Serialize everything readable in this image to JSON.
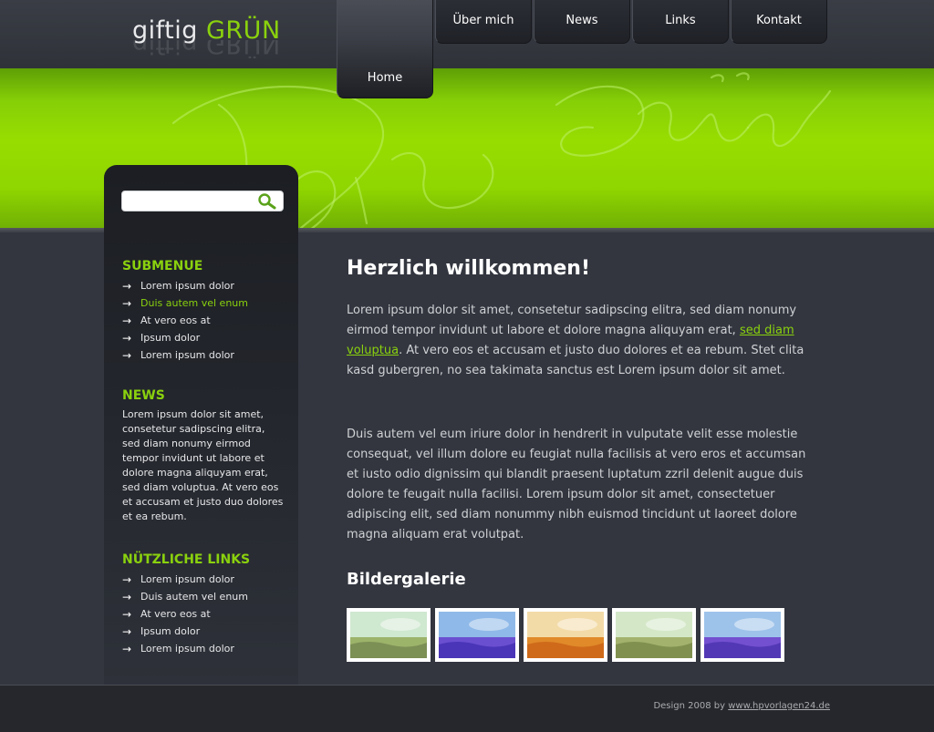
{
  "logo": {
    "part1": "giftig",
    "part2": "GRÜN"
  },
  "nav": {
    "home": "Home",
    "items": [
      "Über mich",
      "News",
      "Links",
      "Kontakt"
    ]
  },
  "colors": {
    "accent": "#8ad10e",
    "background": "#33363f",
    "sidebar": "#1c1e23"
  },
  "search": {
    "placeholder": "",
    "icon": "search-icon"
  },
  "sidebar": {
    "submenu_heading": "SUBMENUE",
    "submenu_items": [
      "Lorem ipsum dolor",
      "Duis autem vel enum",
      "At vero eos at",
      "Ipsum dolor",
      "Lorem ipsum dolor"
    ],
    "submenu_active_index": 1,
    "news_heading": "NEWS",
    "news_text": "Lorem ipsum dolor sit amet, consetetur sadipscing elitra, sed diam nonumy eirmod tempor invidunt ut labore et dolore magna aliquyam erat, sed diam voluptua. At vero eos et accusam et justo duo dolores et ea rebum.",
    "links_heading": "NÜTZLICHE LINKS",
    "links_items": [
      "Lorem ipsum dolor",
      "Duis autem vel enum",
      "At vero eos at",
      "Ipsum dolor",
      "Lorem ipsum dolor"
    ]
  },
  "main": {
    "title": "Herzlich willkommen!",
    "para1_before": "Lorem ipsum dolor sit amet, consetetur sadipscing elitra, sed diam nonumy eirmod tempor invidunt ut labore et dolore magna aliquyam erat, ",
    "para1_link": "sed diam voluptua",
    "para1_after": ". At vero eos et accusam et justo duo dolores et ea rebum. Stet clita kasd gubergren, no sea takimata sanctus est Lorem ipsum dolor sit amet.",
    "para2": "Duis autem vel eum iriure dolor in hendrerit in vulputate velit esse molestie consequat, vel illum dolore eu feugiat nulla facilisis at vero eros et accumsan et iusto odio dignissim qui blandit praesent luptatum zzril delenit augue duis dolore te feugait nulla facilisi. Lorem ipsum dolor sit amet, consectetuer adipiscing elit, sed diam nonummy nibh euismod tincidunt ut laoreet dolore magna aliquam erat volutpat.",
    "gallery_title": "Bildergalerie",
    "gallery": [
      {
        "name": "gallery-thumb-green",
        "sky": "#cfe8d0",
        "field": "#9cb36a",
        "ground": "#7c8f55"
      },
      {
        "name": "gallery-thumb-blue",
        "sky": "#8fb9e8",
        "field": "#6a4fd0",
        "ground": "#4a35b8"
      },
      {
        "name": "gallery-thumb-orange",
        "sky": "#f3dba8",
        "field": "#e08a2a",
        "ground": "#cf6a1a"
      },
      {
        "name": "gallery-thumb-green-2",
        "sky": "#d4e8c8",
        "field": "#a3b36e",
        "ground": "#80914f"
      },
      {
        "name": "gallery-thumb-violet",
        "sky": "#9ec3ea",
        "field": "#7350d0",
        "ground": "#5238b5"
      }
    ]
  },
  "footer": {
    "prefix": "Design 2008 by ",
    "link": "www.hpvorlagen24.de"
  }
}
